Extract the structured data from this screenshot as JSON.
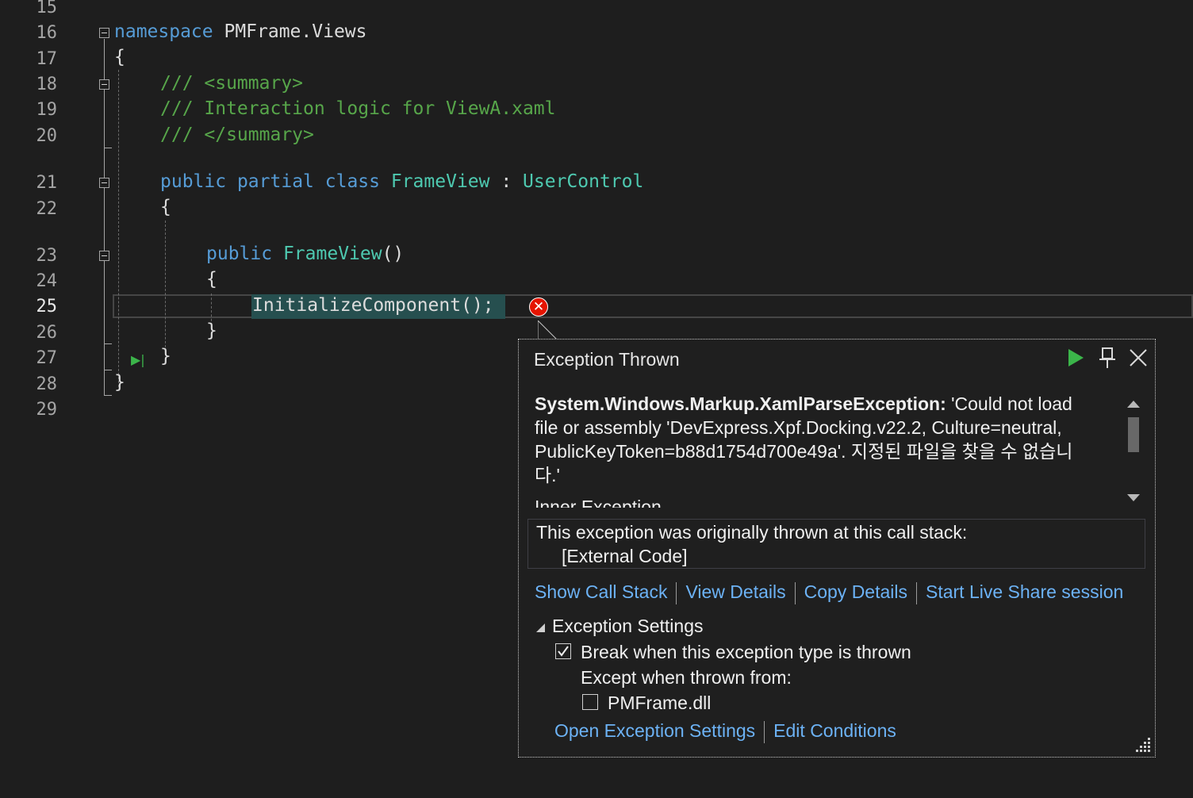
{
  "editor": {
    "line_numbers": [
      "15",
      "16",
      "17",
      "18",
      "19",
      "20",
      "21",
      "22",
      "23",
      "24",
      "25",
      "26",
      "27",
      "28",
      "29"
    ],
    "current_line": "25",
    "code": {
      "l16_kw": "namespace",
      "l16_name": " PMFrame.Views",
      "l17": "{",
      "l18": "/// <summary>",
      "l19": "/// Interaction logic for ViewA.xaml",
      "l20": "/// </summary>",
      "l21_kw1": "public",
      "l21_kw2": "partial",
      "l21_kw3": "class",
      "l21_type": "FrameView",
      "l21_colon": " : ",
      "l21_base": "UserControl",
      "l22": "{",
      "l23_kw": "public",
      "l23_name": "FrameView",
      "l23_parens": "()",
      "l24": "{",
      "l25": "InitializeComponent();",
      "l26": "}",
      "l27": "}",
      "l28": "}"
    }
  },
  "popup": {
    "title": "Exception Thrown",
    "exception_type": "System.Windows.Markup.XamlParseException:",
    "message_line1": " 'Could not load",
    "message_line2": "file or assembly 'DevExpress.Xpf.Docking.v22.2, Culture=neutral,",
    "message_line3": "PublicKeyToken=b88d1754d700e49a'. 지정된 파일을 찾을 수 없습니",
    "message_line4": "다.'",
    "message_line5": "Inner Exception",
    "stack_line1": "This exception was originally thrown at this call stack:",
    "stack_line2": "[External Code]",
    "links": {
      "show_call_stack": "Show Call Stack",
      "view_details": "View Details",
      "copy_details": "Copy Details",
      "live_share": "Start Live Share session"
    },
    "settings_header": "Exception Settings",
    "break_label": "Break when this exception type is thrown",
    "break_checked": true,
    "except_label": "Except when thrown from:",
    "module_label": "PMFrame.dll",
    "module_checked": false,
    "bottom_links": {
      "open_settings": "Open Exception Settings",
      "edit_conditions": "Edit Conditions"
    }
  },
  "colors": {
    "background": "#1e1e1e",
    "keyword": "#569cd6",
    "type": "#4ec9b0",
    "comment": "#57a64a",
    "link": "#6cb2f5",
    "error": "#e51400",
    "continue": "#3bb54a"
  },
  "icons": {
    "error": "error-circle-icon",
    "continue": "play-icon",
    "pin": "pin-icon",
    "close": "close-icon",
    "collapse": "collapse-triangle-icon"
  }
}
